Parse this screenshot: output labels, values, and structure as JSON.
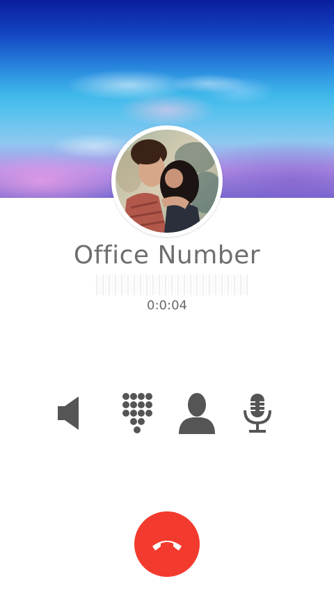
{
  "call": {
    "contact_name": "Office Number",
    "duration": "0:0:04"
  },
  "controls": [
    {
      "id": "speaker",
      "icon": "speaker-icon"
    },
    {
      "id": "dialpad",
      "icon": "dialpad-icon"
    },
    {
      "id": "contact",
      "icon": "contact-icon"
    },
    {
      "id": "mute",
      "icon": "microphone-icon"
    }
  ],
  "end_call": {
    "icon": "phone-hangup-icon"
  },
  "colors": {
    "icon": "#555555",
    "end_call": "#f23b2e",
    "name_text": "#6e6e6e",
    "timer_text": "#6a6a6a"
  }
}
